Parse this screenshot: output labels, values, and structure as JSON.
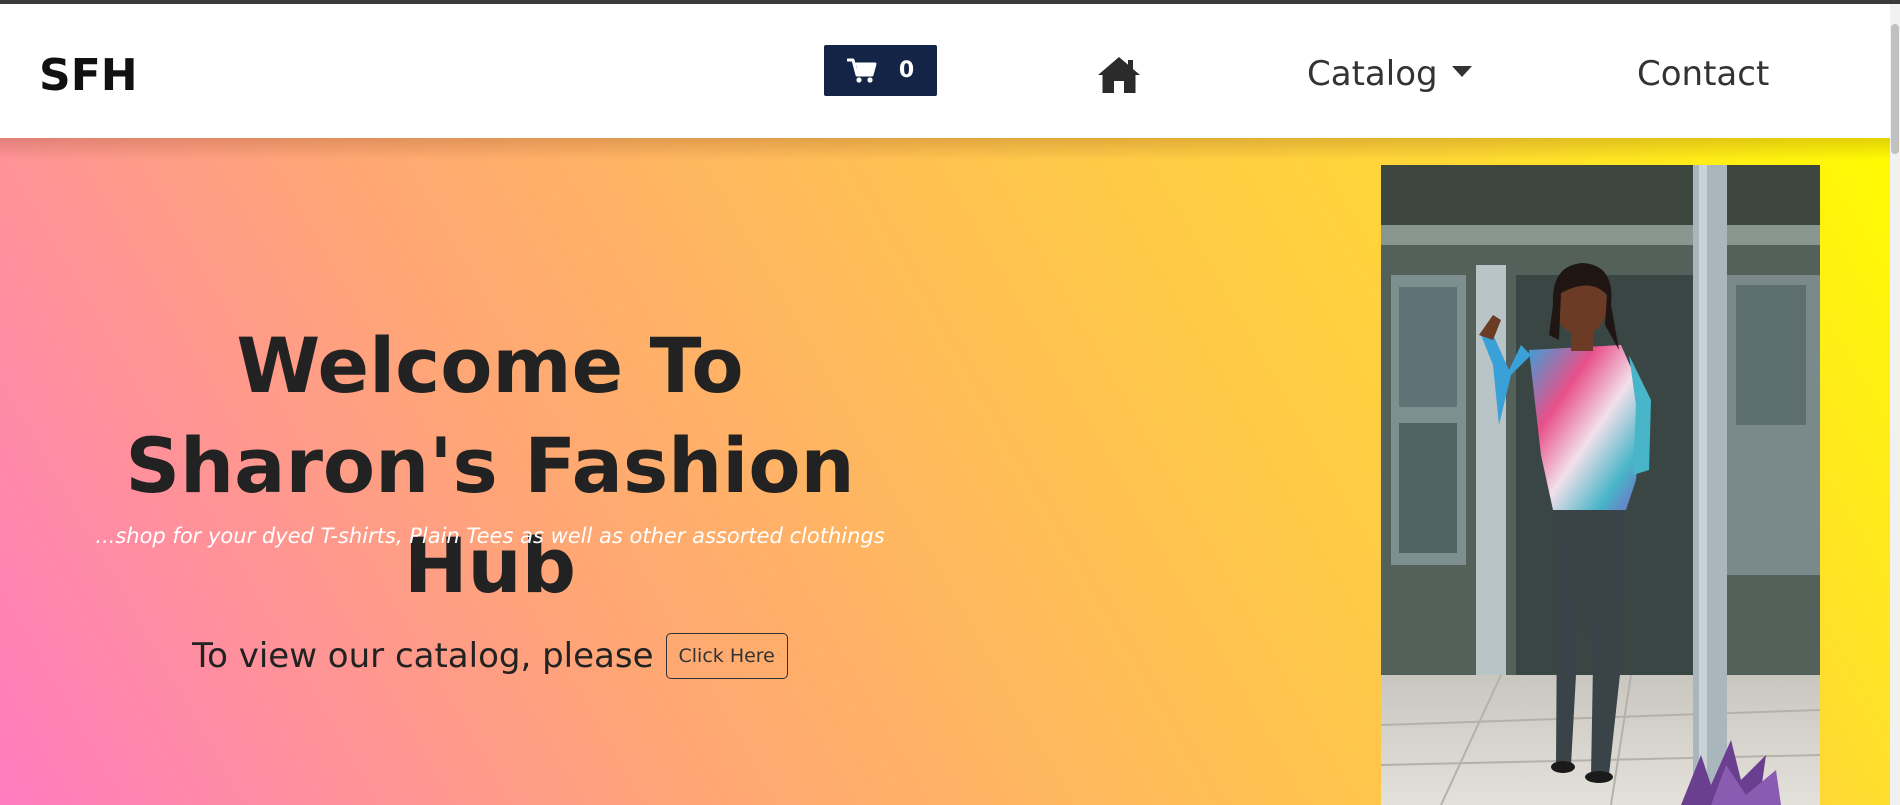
{
  "navbar": {
    "brand": "SFH",
    "cart": {
      "count": "0",
      "icon": "cart-icon"
    },
    "home": {
      "icon": "home-icon"
    },
    "catalog_label": "Catalog",
    "contact_label": "Contact"
  },
  "hero": {
    "title_line1": "Welcome To",
    "title_line2": "Sharon's Fashion Hub",
    "subtitle": "...shop for your dyed T-shirts, Plain Tees as well as other assorted clothings",
    "cta_text": "To view our catalog, please",
    "cta_button": "Click Here"
  },
  "colors": {
    "cart_bg": "#132447",
    "gradient_start": "#ff7cbf",
    "gradient_mid": "#ffc34f",
    "gradient_end": "#fffc00",
    "text_dark": "#222222"
  }
}
